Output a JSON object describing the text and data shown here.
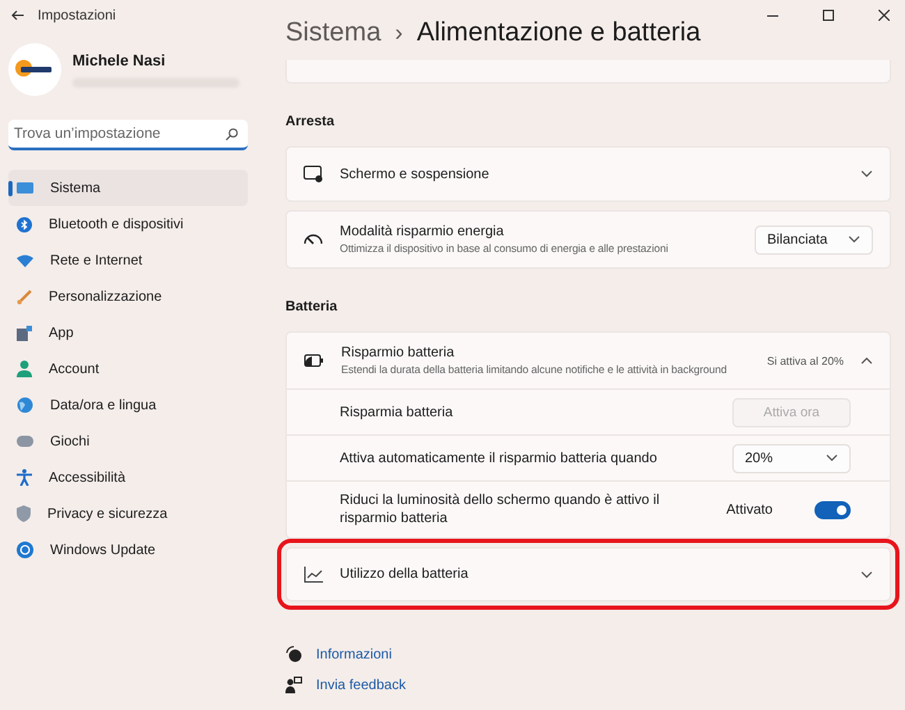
{
  "window": {
    "title": "Impostazioni"
  },
  "profile": {
    "name": "Michele Nasi"
  },
  "search": {
    "placeholder": "Trova un’impostazione"
  },
  "nav": [
    {
      "label": "Sistema",
      "selected": true
    },
    {
      "label": "Bluetooth e dispositivi",
      "selected": false
    },
    {
      "label": "Rete e Internet",
      "selected": false
    },
    {
      "label": "Personalizzazione",
      "selected": false
    },
    {
      "label": "App",
      "selected": false
    },
    {
      "label": "Account",
      "selected": false
    },
    {
      "label": "Data/ora e lingua",
      "selected": false
    },
    {
      "label": "Giochi",
      "selected": false
    },
    {
      "label": "Accessibilità",
      "selected": false
    },
    {
      "label": "Privacy e sicurezza",
      "selected": false
    },
    {
      "label": "Windows Update",
      "selected": false
    }
  ],
  "breadcrumb": {
    "parent": "Sistema",
    "separator": "›",
    "current": "Alimentazione e batteria"
  },
  "sections": [
    {
      "heading": "Arresta",
      "cards": [
        {
          "kind": "expander",
          "title": "Schermo e sospensione",
          "expanded": false,
          "highlighted": false
        },
        {
          "kind": "select",
          "title": "Modalità risparmio energia",
          "description": "Ottimizza il dispositivo in base al consumo di energia e alle prestazioni",
          "value": "Bilanciata",
          "highlighted": false
        }
      ]
    },
    {
      "heading": "Batteria",
      "cards": [
        {
          "kind": "expander",
          "title": "Risparmio batteria",
          "description": "Estendi la durata della batteria limitando alcune notifiche e le attività in background",
          "status": "Si attiva al 20%",
          "expanded": true,
          "highlighted": false,
          "rows": [
            {
              "kind": "button",
              "label": "Risparmia batteria",
              "button": "Attiva ora",
              "disabled": true
            },
            {
              "kind": "select",
              "label": "Attiva automaticamente il risparmio batteria quando",
              "value": "20%"
            },
            {
              "kind": "toggle",
              "label": "Riduci la luminosità dello schermo quando è attivo il risparmio batteria",
              "state": "Attivato",
              "on": true
            }
          ]
        },
        {
          "kind": "expander",
          "title": "Utilizzo della batteria",
          "expanded": false,
          "highlighted": true
        }
      ]
    }
  ],
  "links": [
    "Informazioni",
    "Invia feedback"
  ]
}
